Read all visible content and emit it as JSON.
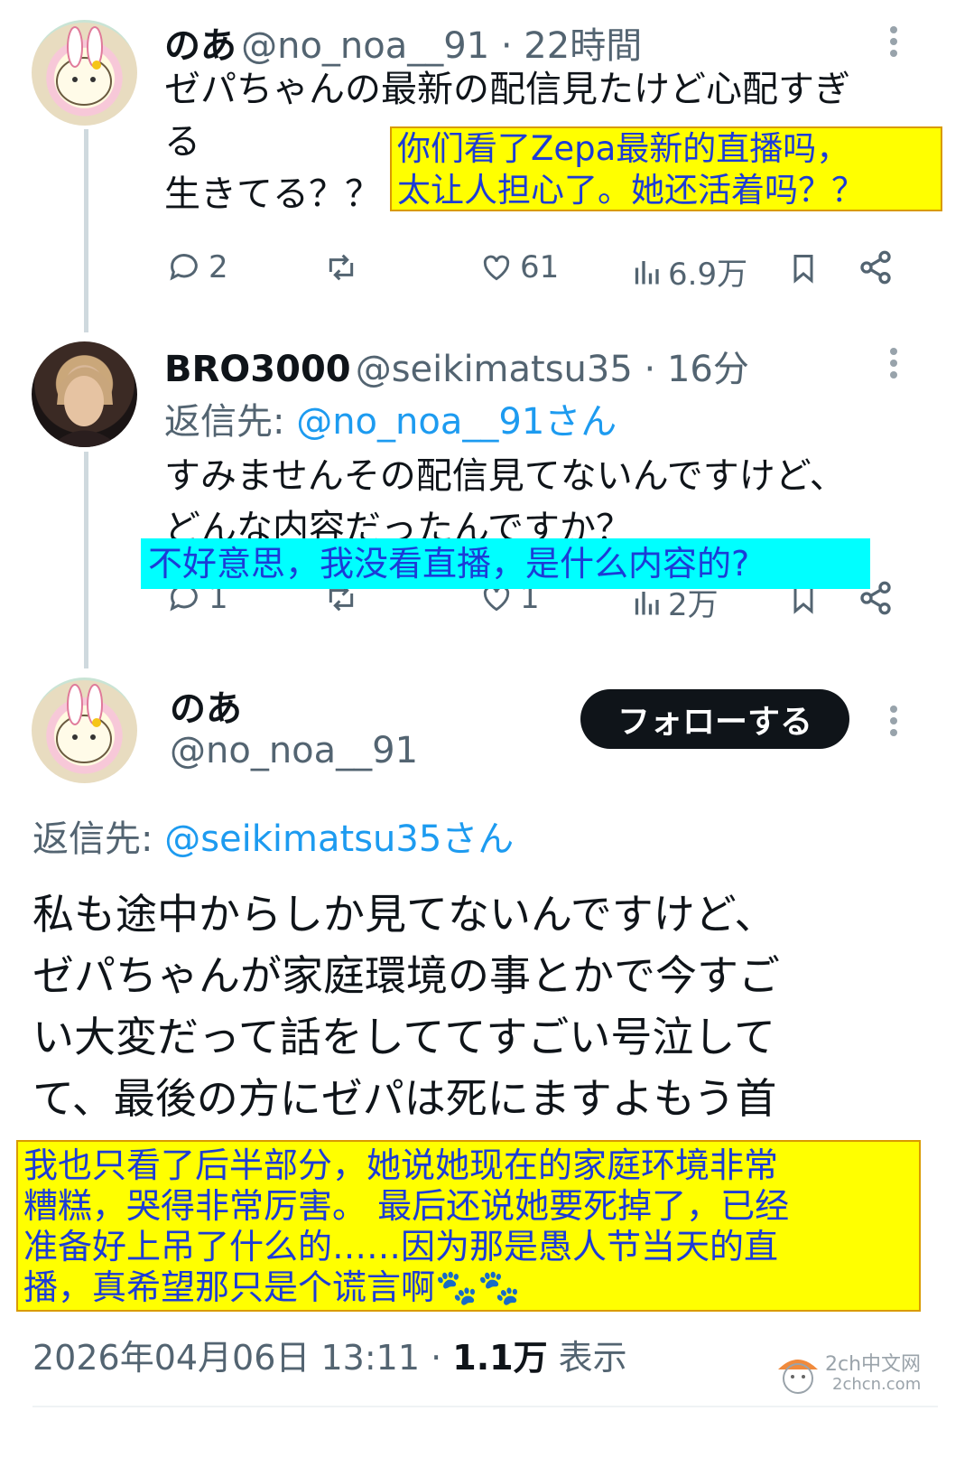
{
  "tweet1": {
    "display_name": "のあ",
    "handle_time": "@no_noa__91 · 22時間",
    "text_line1": "ゼパちゃんの最新の配信見たけど心配すぎ",
    "text_line2": "る",
    "text_line3": "生きてる？？",
    "overlay_line1": "你们看了Zepa最新的直播吗，",
    "overlay_line2": "太让人担心了。她还活着吗？？",
    "replies": "2",
    "likes": "61",
    "views": "6.9万"
  },
  "tweet2": {
    "display_name": "BRO3000",
    "handle_time": "@seikimatsu35 · 16分",
    "reply_to_prefix": "返信先:",
    "reply_to_handle": "@no_noa__91さん",
    "text_line1": "すみませんその配信見てないんですけど、",
    "text_line2": "どんな内容だったんですか？",
    "overlay": "不好意思，我没看直播，是什么内容的?",
    "replies": "1",
    "likes": "1",
    "views": "2万"
  },
  "tweet3": {
    "display_name": "のあ",
    "handle": "@no_noa__91",
    "follow_label": "フォローする",
    "reply_to_prefix": "返信先:",
    "reply_to_handle": "@seikimatsu35さん",
    "text_line1": "私も途中からしか見てないんですけど、",
    "text_line2": "ゼパちゃんが家庭環境の事とかで今すご",
    "text_line3": "い大変だって話をしててすごい号泣して",
    "text_line4": "て、最後の方にゼパは死にますよもう首",
    "overlay_line1": "我也只看了后半部分，她说她现在的家庭环境非常",
    "overlay_line2": "糟糕，哭得非常厉害。 最后还说她要死掉了，已经",
    "overlay_line3": "准备好上吊了什么的……因为那是愚人节当天的直",
    "overlay_line4": "播，真希望那只是个谎言啊🐾🐾",
    "timestamp": "2026年04月06日 13:11 · ",
    "view_count": "1.1万",
    "view_label": " 表示"
  },
  "watermark": {
    "line1": "2ch中文网",
    "line2": "2chcn.com"
  },
  "colors": {
    "link": "#1d9bf0",
    "muted": "#536471",
    "overlay_yellow": "#ffff00",
    "overlay_cyan": "#00ffff",
    "overlay_text": "#1c3cd6"
  }
}
